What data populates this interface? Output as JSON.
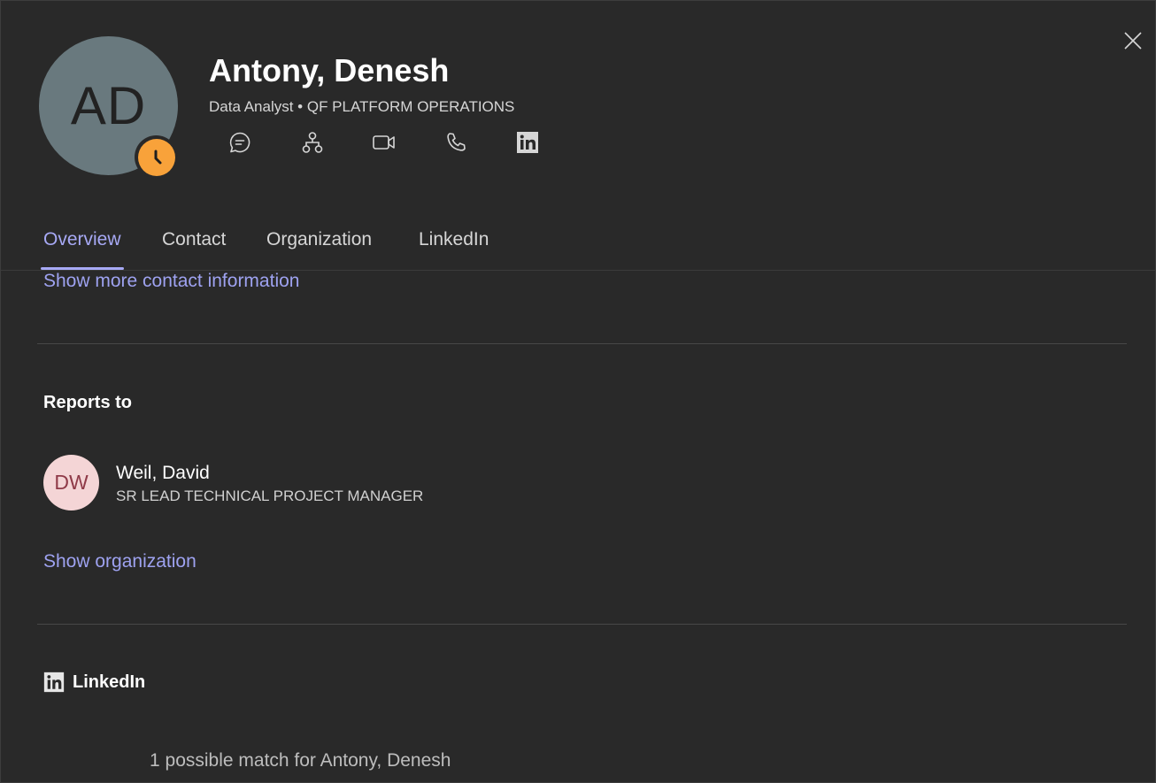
{
  "profile": {
    "initials": "AD",
    "name": "Antony, Denesh",
    "subtitle": "Data Analyst • QF PLATFORM OPERATIONS",
    "presence": "clock-icon",
    "presence_color": "#f8a23a"
  },
  "actions": [
    {
      "icon": "chat-icon"
    },
    {
      "icon": "org-chart-icon"
    },
    {
      "icon": "video-call-icon"
    },
    {
      "icon": "phone-icon"
    },
    {
      "icon": "linkedin-icon"
    }
  ],
  "tabs": [
    {
      "label": "Overview",
      "active": true
    },
    {
      "label": "Contact",
      "active": false
    },
    {
      "label": "Organization",
      "active": false
    },
    {
      "label": "LinkedIn",
      "active": false
    }
  ],
  "overview": {
    "show_more_contact": "Show more contact information",
    "reports_to_title": "Reports to",
    "manager": {
      "initials": "DW",
      "name": "Weil, David",
      "title": "SR LEAD TECHNICAL PROJECT MANAGER"
    },
    "show_organization": "Show organization",
    "linkedin_title": "LinkedIn",
    "linkedin_match": "1 possible match for Antony, Denesh"
  },
  "colors": {
    "background": "#292929",
    "accent": "#a7a9f5",
    "link": "#9ea2f0"
  }
}
